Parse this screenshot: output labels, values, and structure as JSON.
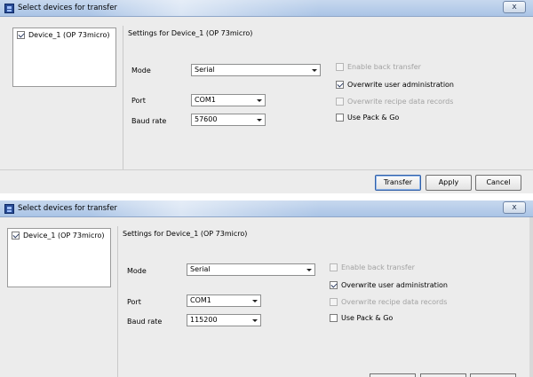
{
  "dialogs": [
    {
      "title": "Select devices for transfer",
      "close_label": "x",
      "device": {
        "label": "Device_1 (OP 73micro)",
        "checked": true
      },
      "settings_title": "Settings for Device_1 (OP 73micro)",
      "mode": {
        "label": "Mode",
        "value": "Serial"
      },
      "port": {
        "label": "Port",
        "value": "COM1"
      },
      "baud": {
        "label": "Baud rate",
        "value": "57600"
      },
      "options": [
        {
          "label": "Enable back transfer",
          "checked": false,
          "enabled": false
        },
        {
          "label": "Overwrite user administration",
          "checked": true,
          "enabled": true
        },
        {
          "label": "Overwrite recipe data records",
          "checked": false,
          "enabled": false
        },
        {
          "label": "Use Pack & Go",
          "checked": false,
          "enabled": true
        }
      ],
      "buttons": {
        "transfer": "Transfer",
        "apply": "Apply",
        "cancel": "Cancel"
      }
    },
    {
      "title": "Select devices for transfer",
      "close_label": "x",
      "device": {
        "label": "Device_1 (OP 73micro)",
        "checked": true
      },
      "settings_title": "Settings for Device_1 (OP 73micro)",
      "mode": {
        "label": "Mode",
        "value": "Serial"
      },
      "port": {
        "label": "Port",
        "value": "COM1"
      },
      "baud": {
        "label": "Baud rate",
        "value": "115200"
      },
      "options": [
        {
          "label": "Enable back transfer",
          "checked": false,
          "enabled": false
        },
        {
          "label": "Overwrite user administration",
          "checked": true,
          "enabled": true
        },
        {
          "label": "Overwrite recipe data records",
          "checked": false,
          "enabled": false
        },
        {
          "label": "Use Pack & Go",
          "checked": false,
          "enabled": true
        }
      ]
    }
  ]
}
